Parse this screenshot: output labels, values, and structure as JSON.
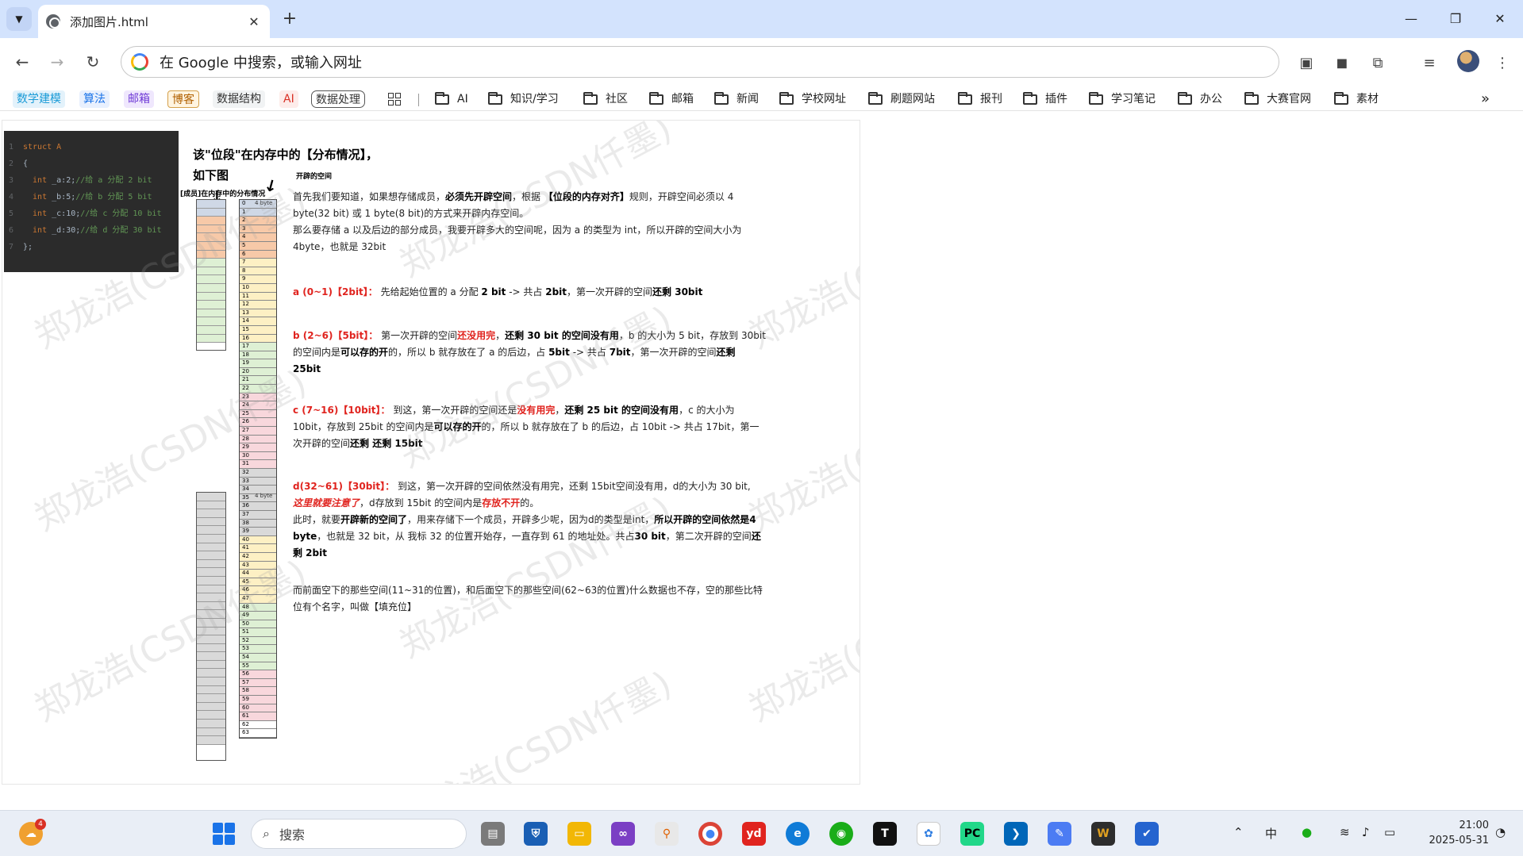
{
  "tab": {
    "title": "添加图片.html",
    "close": "✕",
    "new": "+"
  },
  "window": {
    "minimize": "—",
    "restore": "❐",
    "close": "✕"
  },
  "toolbar": {
    "back": "←",
    "forward": "→",
    "reload": "↻",
    "omnibox_text": "在 Google 中搜索，或输入网址"
  },
  "bookmarks": {
    "chips": [
      {
        "label": "数学建模",
        "color": "#1a9bd7",
        "bg": "#e3f2fb"
      },
      {
        "label": "算法",
        "color": "#1a73e8",
        "bg": "#e8f0fe"
      },
      {
        "label": "邮箱",
        "color": "#6f3ad6",
        "bg": "#efe7fd"
      },
      {
        "label": "博客",
        "color": "#b06000",
        "bg": "#fff4e0"
      },
      {
        "label": "数据结构",
        "color": "#333333",
        "bg": "#f1f3f4"
      },
      {
        "label": "AI",
        "color": "#d93025",
        "bg": "#fdecea"
      },
      {
        "label": "数据处理",
        "color": "#333333",
        "bg": "#ffffff"
      }
    ],
    "folders": [
      "AI",
      "知识/学习",
      "社区",
      "邮箱",
      "新闻",
      "学校网址",
      "刷题网站",
      "报刊",
      "插件",
      "学习笔记",
      "办公",
      "大赛官网",
      "素材"
    ],
    "more": "»"
  },
  "code": {
    "lines": [
      {
        "n": "1",
        "kw": "struct A",
        "rest": ""
      },
      {
        "n": "2",
        "kw": "",
        "rest": "{"
      },
      {
        "n": "3",
        "kw": "  int",
        "rest": " _a:2;",
        "cm": "//给 a 分配 2 bit"
      },
      {
        "n": "4",
        "kw": "  int",
        "rest": " _b:5;",
        "cm": "//给 b 分配 5 bit"
      },
      {
        "n": "5",
        "kw": "  int",
        "rest": " _c:10;",
        "cm": "//给 c 分配 10 bit"
      },
      {
        "n": "6",
        "kw": "  int",
        "rest": " _d:30;",
        "cm": "//给 d 分配 30 bit"
      },
      {
        "n": "7",
        "kw": "",
        "rest": "};"
      }
    ]
  },
  "diagram": {
    "title_line1": "该\"位段\"在内存中的【分布情况】，",
    "title_line2": "如下图",
    "label_members": "[成员]在内存中的分布情况",
    "label_space": "开辟的空间",
    "byte_label": "4 byte"
  },
  "text": {
    "p1_a": "首先我们要知道，如果想存储成员，",
    "p1_b": "必须先开辟空间",
    "p1_c": "，根据 ",
    "p1_d": "【位段的内存对齐】",
    "p1_e": "规则，开辟空间必须以 4 byte(32 bit) 或 1 byte(8 bit)的方式来开辟内存空间。",
    "p2": "那么要存储 a 以及后边的部分成员，我要开辟多大的空间呢，因为 a 的类型为 int，所以开辟的空间大小为 4byte，也就是 32bit",
    "a_head": "a (0~1)【2bit】：",
    "a_1": " 先给起始位置的 a 分配 ",
    "a_2": "2 bit",
    "a_3": " -> 共占 ",
    "a_4": "2bit",
    "a_5": "，第一次开辟的空间",
    "a_6": "还剩 30bit",
    "b_head": "b (2~6)【5bit】：",
    "b_1": " 第一次开辟的空间",
    "b_2": "还没用完",
    "b_3": "，",
    "b_4": "还剩 30 bit 的空间没有用",
    "b_5": "，b 的大小为 5 bit，存放到 30bit 的空间内是",
    "b_6": "可以存的开",
    "b_7": "的，所以 b 就存放在了 a 的后边，占 ",
    "b_8": "5bit",
    "b_9": " -> 共占 ",
    "b_10": "7bit",
    "b_11": "，第一次开辟的空间",
    "b_12": "还剩 25bit",
    "c_head": "c (7~16)【10bit】：",
    "c_1": " 到这，第一次开辟的空间还是",
    "c_2": "没有用完",
    "c_3": "，",
    "c_4": "还剩 25 bit 的空间没有用",
    "c_5": "，c 的大小为 10bit，存放到 25bit 的空间内是",
    "c_6": "可以存的开",
    "c_7": "的，所以 b 就存放在了 b 的后边，占 10bit -> 共占 17bit，第一次开辟的空间",
    "c_8": "还剩 还剩 15bit",
    "d_head": "d(32~61)【30bit】：",
    "d_1": " 到这，第一次开辟的空间依然没有用完，还剩 15bit空间没有用，d的大小为 30 bit,",
    "d_2": "这里就要注意了",
    "d_3": "，d存放到 15bit 的空间内是",
    "d_4": "存放不开",
    "d_5": "的。",
    "d_6": "此时，就要",
    "d_7": "开辟新的空间了",
    "d_8": "，用来存储下一个成员，开辟多少呢，因为d的类型是int，",
    "d_9": "所以开辟的空间依然是4 byte",
    "d_10": "，也就是 32 bit，从 我标 32 的位置开始存，一直存到 61 的地址处。共占",
    "d_11": "30 bit",
    "d_12": "，第二次开辟的空间",
    "d_13": "还剩 2bit",
    "last": "而前面空下的那些空间(11~31的位置)，和后面空下的那些空间(62~63的位置)什么数据也不存，空的那些比特位有个名字，叫做【填充位】"
  },
  "watermark": "郑龙浩(CSDN仟墨)",
  "taskbar": {
    "search": "搜索",
    "weather_badge": "4",
    "ime": "中",
    "time": "21:00",
    "date": "2025-05-31"
  }
}
